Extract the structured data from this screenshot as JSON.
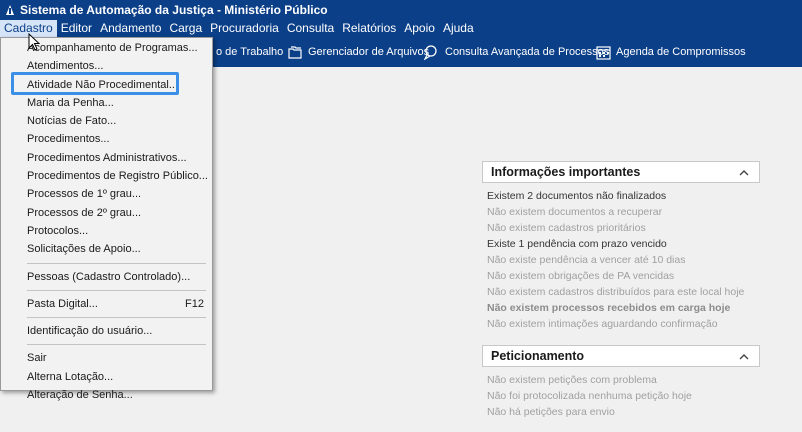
{
  "titlebar": {
    "title": "Sistema de Automação da Justiça - Ministério Público"
  },
  "menubar": {
    "items": [
      "Cadastro",
      "Editor",
      "Andamento",
      "Carga",
      "Procuradoria",
      "Consulta",
      "Relatórios",
      "Apoio",
      "Ajuda"
    ]
  },
  "toolbar": {
    "items": [
      {
        "label": "o de Trabalho",
        "icon": "desk-icon"
      },
      {
        "label": "Gerenciador de Arquivos",
        "icon": "folders-icon"
      },
      {
        "label": "Consulta Avançada de Processos",
        "icon": "search-chat-icon"
      },
      {
        "label": "Agenda de Compromissos",
        "icon": "calendar-icon"
      }
    ]
  },
  "dropdown": {
    "items": [
      "Acompanhamento de Programas...",
      "Atendimentos...",
      "Atividade Não Procedimental...",
      "Maria da Penha...",
      "Notícias de Fato...",
      "Procedimentos...",
      "Procedimentos Administrativos...",
      "Procedimentos de Registro Público...",
      "Processos de 1º grau...",
      "Processos de 2º grau...",
      "Protocolos...",
      "Solicitações de Apoio..."
    ],
    "group2": [
      "Pessoas (Cadastro Controlado)..."
    ],
    "group3": [
      {
        "label": "Pasta Digital...",
        "shortcut": "F12"
      }
    ],
    "group4": [
      "Identificação do usuário..."
    ],
    "group5": [
      "Sair",
      "Alterna Lotação...",
      "Alteração de Senha..."
    ]
  },
  "info_panel": {
    "title": "Informações importantes",
    "lines": [
      "Existem 2 documentos não finalizados",
      "Não existem documentos a recuperar",
      "Não existem cadastros prioritários",
      "Existe 1 pendência com prazo vencido",
      "Não existe pendência a vencer até 10 dias",
      "Não existem obrigações de PA vencidas",
      "Não existem cadastros distribuídos para este local hoje",
      "Não existem processos recebidos em carga hoje",
      "Não existem intimações aguardando confirmação"
    ]
  },
  "petition_panel": {
    "title": "Peticionamento",
    "lines": [
      "Não existem petições com problema",
      "Não foi protocolizada nenhuma petição hoje",
      "Não há petições para envio"
    ]
  },
  "colors": {
    "brand": "#0b3f88",
    "highlight": "#3b8fe6"
  }
}
